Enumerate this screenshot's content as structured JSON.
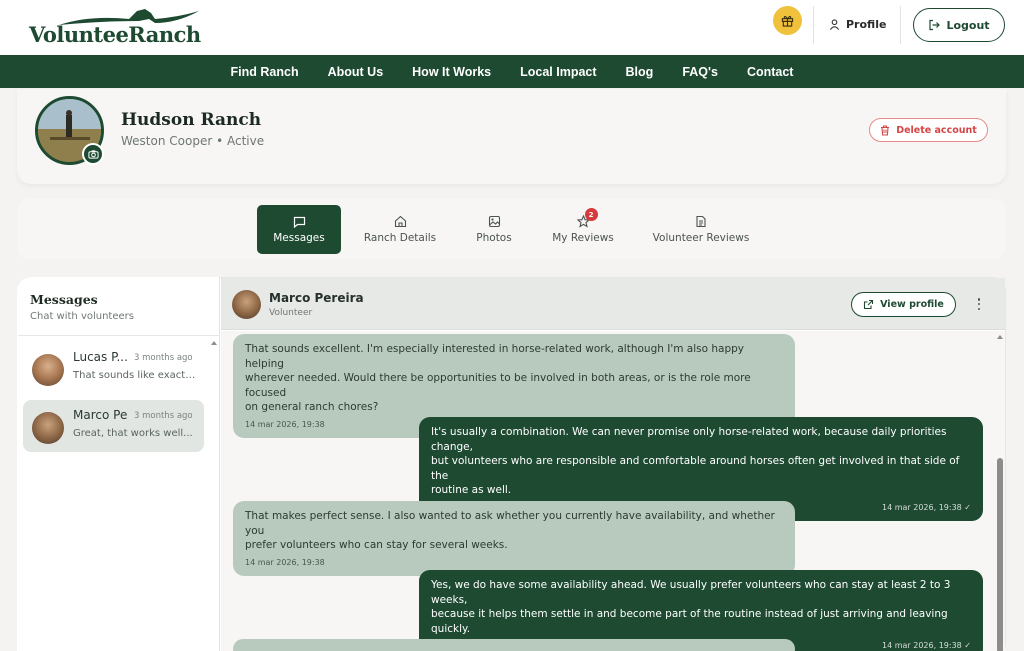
{
  "brand": {
    "logo_text": "VolunteeRanch",
    "accent": "#1e4a32",
    "gift_color": "#f0c23b"
  },
  "header": {
    "profile_label": "Profile",
    "logout_label": "Logout"
  },
  "nav": [
    "Find Ranch",
    "About Us",
    "How It Works",
    "Local Impact",
    "Blog",
    "FAQ's",
    "Contact"
  ],
  "profile": {
    "name": "Hudson Ranch",
    "subtitle": "Weston Cooper • Active",
    "delete_label": "Delete account"
  },
  "tabs": [
    {
      "label": "Messages",
      "icon": "chat-icon",
      "active": true
    },
    {
      "label": "Ranch Details",
      "icon": "home-icon"
    },
    {
      "label": "Photos",
      "icon": "image-icon"
    },
    {
      "label": "My Reviews",
      "icon": "star-icon",
      "badge": "2"
    },
    {
      "label": "Volunteer Reviews",
      "icon": "document-icon"
    }
  ],
  "sidebar": {
    "title": "Messages",
    "subtitle": "Chat with volunteers",
    "conversations": [
      {
        "name": "Lucas P...",
        "time": "3 months ago",
        "preview": "That sounds like exactl..."
      },
      {
        "name": "Marco Pe",
        "time": "3 months ago",
        "preview": "Great, that works well...",
        "selected": true
      }
    ]
  },
  "chat": {
    "name": "Marco Pereira",
    "role": "Volunteer",
    "view_profile_label": "View profile",
    "messages": [
      {
        "dir": "in",
        "lines": [
          "That sounds excellent. I'm especially interested in horse-related work, although I'm also happy helping",
          "wherever needed. Would there be opportunities to be involved in both areas, or is the role more focused",
          "on general ranch chores?"
        ],
        "time": "14 mar 2026, 19:38"
      },
      {
        "dir": "out",
        "lines": [
          "It's usually a combination. We can never promise only horse-related work, because daily priorities change,",
          "but volunteers who are responsible and comfortable around horses often get involved in that side of the",
          "routine as well."
        ],
        "time": "14 mar 2026, 19:38 ✓"
      },
      {
        "dir": "in",
        "lines": [
          "That makes perfect sense. I also wanted to ask whether you currently have availability, and whether you",
          "prefer volunteers who can stay for several weeks."
        ],
        "time": "14 mar 2026, 19:38"
      },
      {
        "dir": "out",
        "lines": [
          "Yes, we do have some availability ahead. We usually prefer volunteers who can stay at least 2 to 3 weeks,",
          "because it helps them settle in and become part of the routine instead of just arriving and leaving quickly."
        ],
        "time": "14 mar 2026, 19:38 ✓"
      }
    ]
  }
}
